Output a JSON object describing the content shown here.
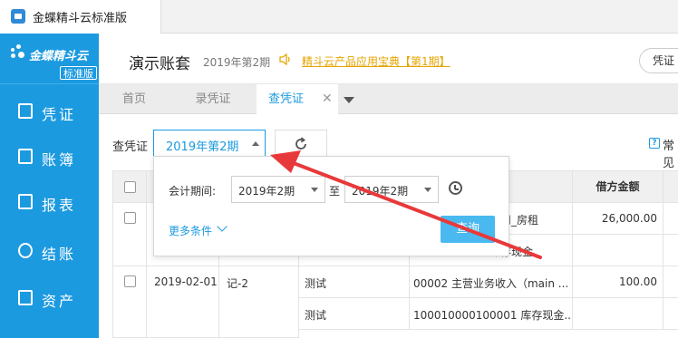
{
  "browser_tab": {
    "title": "金蝶精斗云标准版"
  },
  "brand": {
    "name": "金蝶精斗云",
    "edition": "标准版"
  },
  "sidebar": {
    "items": [
      {
        "label": "凭证",
        "icon": "edit-voucher-icon"
      },
      {
        "label": "账簿",
        "icon": "ledger-icon"
      },
      {
        "label": "报表",
        "icon": "report-icon"
      },
      {
        "label": "结账",
        "icon": "closing-icon"
      },
      {
        "label": "资产",
        "icon": "asset-icon"
      }
    ]
  },
  "header": {
    "account_name": "演示账套",
    "period": "2019年第2期",
    "promo": "精斗云产品应用宝典【第1期】",
    "voucher_button": "凭证"
  },
  "tabs": [
    {
      "label": "首页"
    },
    {
      "label": "录凭证"
    },
    {
      "label": "查凭证",
      "active": true
    }
  ],
  "filter": {
    "label": "查凭证",
    "period_value": "2019年第2期",
    "help_text": "常见"
  },
  "popover": {
    "period_label": "会计期间:",
    "from_value": "2019年2期",
    "to_label": "至",
    "to_value": "2019年2期",
    "more_conditions": "更多条件",
    "query_button": "查询"
  },
  "table": {
    "headers": {
      "debit": "借方金额"
    },
    "rows": [
      {
        "date": "",
        "number": "",
        "summary": "",
        "subject": "费用_房租",
        "debit": "26,000.00"
      },
      {
        "date": "",
        "number": "",
        "summary": "",
        "subject": "库存现金",
        "debit": ""
      },
      {
        "date": "2019-02-01",
        "number": "记-2",
        "summary": "测试",
        "subject": "00002 主营业务收入（main ...",
        "debit": "100.00"
      },
      {
        "date": "",
        "number": "",
        "summary": "测试",
        "subject": "100010000100001 库存现金...",
        "debit": ""
      }
    ]
  },
  "colors": {
    "accent": "#1c9ae0",
    "arrow": "#e8393a",
    "promo": "#e6a400"
  }
}
